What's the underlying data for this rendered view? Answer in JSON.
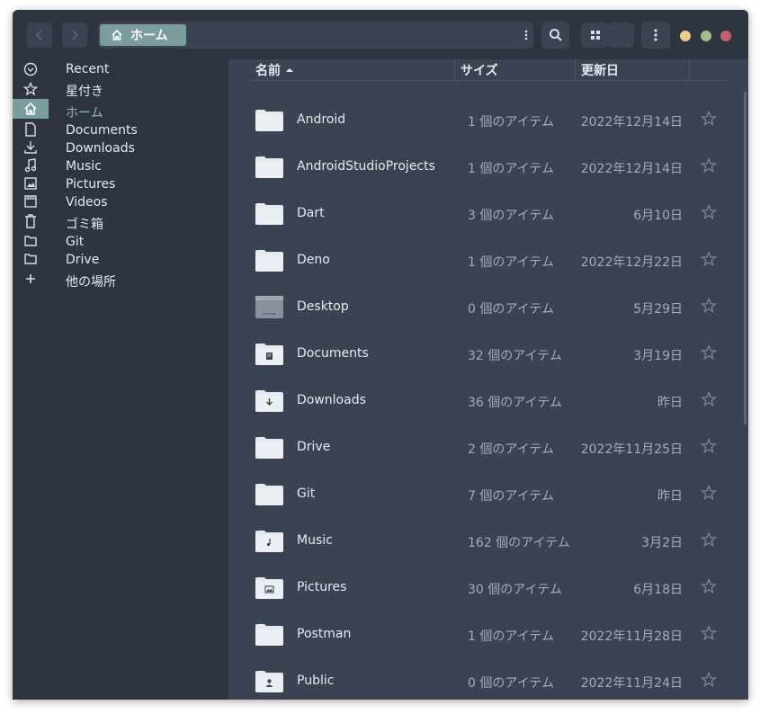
{
  "header": {
    "breadcrumb": "ホーム",
    "icons": {
      "back": "chevron-left-icon",
      "forward": "chevron-right-icon",
      "search": "search-icon",
      "view": "grid-view-icon",
      "menu": "kebab-menu-icon"
    },
    "window_controls": {
      "minimize": "#ebcb8b",
      "maximize": "#a3be8c",
      "close": "#bf616a"
    }
  },
  "sidebar": {
    "items": [
      {
        "label": "Recent",
        "icon": "recent-icon"
      },
      {
        "label": "星付き",
        "icon": "star-icon"
      },
      {
        "label": "ホーム",
        "icon": "home-icon",
        "active": true
      },
      {
        "label": "Documents",
        "icon": "document-icon"
      },
      {
        "label": "Downloads",
        "icon": "download-icon"
      },
      {
        "label": "Music",
        "icon": "music-icon"
      },
      {
        "label": "Pictures",
        "icon": "picture-icon"
      },
      {
        "label": "Videos",
        "icon": "video-icon"
      },
      {
        "label": "ゴミ箱",
        "icon": "trash-icon"
      },
      {
        "label": "Git",
        "icon": "folder-icon"
      },
      {
        "label": "Drive",
        "icon": "folder-icon"
      },
      {
        "label": "他の場所",
        "icon": "plus-icon"
      }
    ]
  },
  "columns": {
    "name": "名前",
    "size": "サイズ",
    "modified": "更新日"
  },
  "files": [
    {
      "name": "Android",
      "size": "1 個のアイテム",
      "modified": "2022年12月14日",
      "emblem": "none"
    },
    {
      "name": "AndroidStudioProjects",
      "size": "1 個のアイテム",
      "modified": "2022年12月14日",
      "emblem": "none"
    },
    {
      "name": "Dart",
      "size": "3 個のアイテム",
      "modified": "6月10日",
      "emblem": "none"
    },
    {
      "name": "Deno",
      "size": "1 個のアイテム",
      "modified": "2022年12月22日",
      "emblem": "none"
    },
    {
      "name": "Desktop",
      "size": "0 個のアイテム",
      "modified": "5月29日",
      "emblem": "desktop"
    },
    {
      "name": "Documents",
      "size": "32 個のアイテム",
      "modified": "3月19日",
      "emblem": "document"
    },
    {
      "name": "Downloads",
      "size": "36 個のアイテム",
      "modified": "昨日",
      "emblem": "download"
    },
    {
      "name": "Drive",
      "size": "2 個のアイテム",
      "modified": "2022年11月25日",
      "emblem": "none"
    },
    {
      "name": "Git",
      "size": "7 個のアイテム",
      "modified": "昨日",
      "emblem": "none"
    },
    {
      "name": "Music",
      "size": "162 個のアイテム",
      "modified": "3月2日",
      "emblem": "music"
    },
    {
      "name": "Pictures",
      "size": "30 個のアイテム",
      "modified": "6月18日",
      "emblem": "picture"
    },
    {
      "name": "Postman",
      "size": "1 個のアイテム",
      "modified": "2022年11月28日",
      "emblem": "none"
    },
    {
      "name": "Public",
      "size": "0 個のアイテム",
      "modified": "2022年11月24日",
      "emblem": "user"
    }
  ],
  "colors": {
    "accent": "#7b9e9c",
    "background": "#3b4252",
    "sidebar": "#2e3440"
  }
}
